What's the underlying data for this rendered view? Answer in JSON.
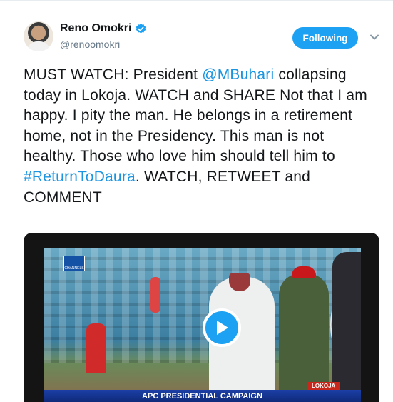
{
  "author": {
    "name": "Reno Omokri",
    "handle": "@renoomokri",
    "verified_icon": "verified-badge-icon"
  },
  "follow_button": {
    "label": "Following",
    "color": "#1da1f2"
  },
  "more_menu": {
    "icon": "chevron-down-icon"
  },
  "tweet": {
    "part1": "MUST WATCH: President ",
    "mention": "@MBuhari",
    "part2": " collapsing today in Lokoja. WATCH and SHARE Not that I am happy. I pity the man. He belongs in a retirement home, not in the Presidency. This man is not healthy. Those who love him should tell him to ",
    "hashtag": "#ReturnToDaura",
    "part3": ". WATCH, RETWEET and COMMENT",
    "link_color": "#1b95e0"
  },
  "video": {
    "play_icon": "play-icon",
    "channel_logo_text": "CHANNELS",
    "ticker": "APC PRESIDENTIAL CAMPAIGN",
    "location": "LOKOJA"
  }
}
